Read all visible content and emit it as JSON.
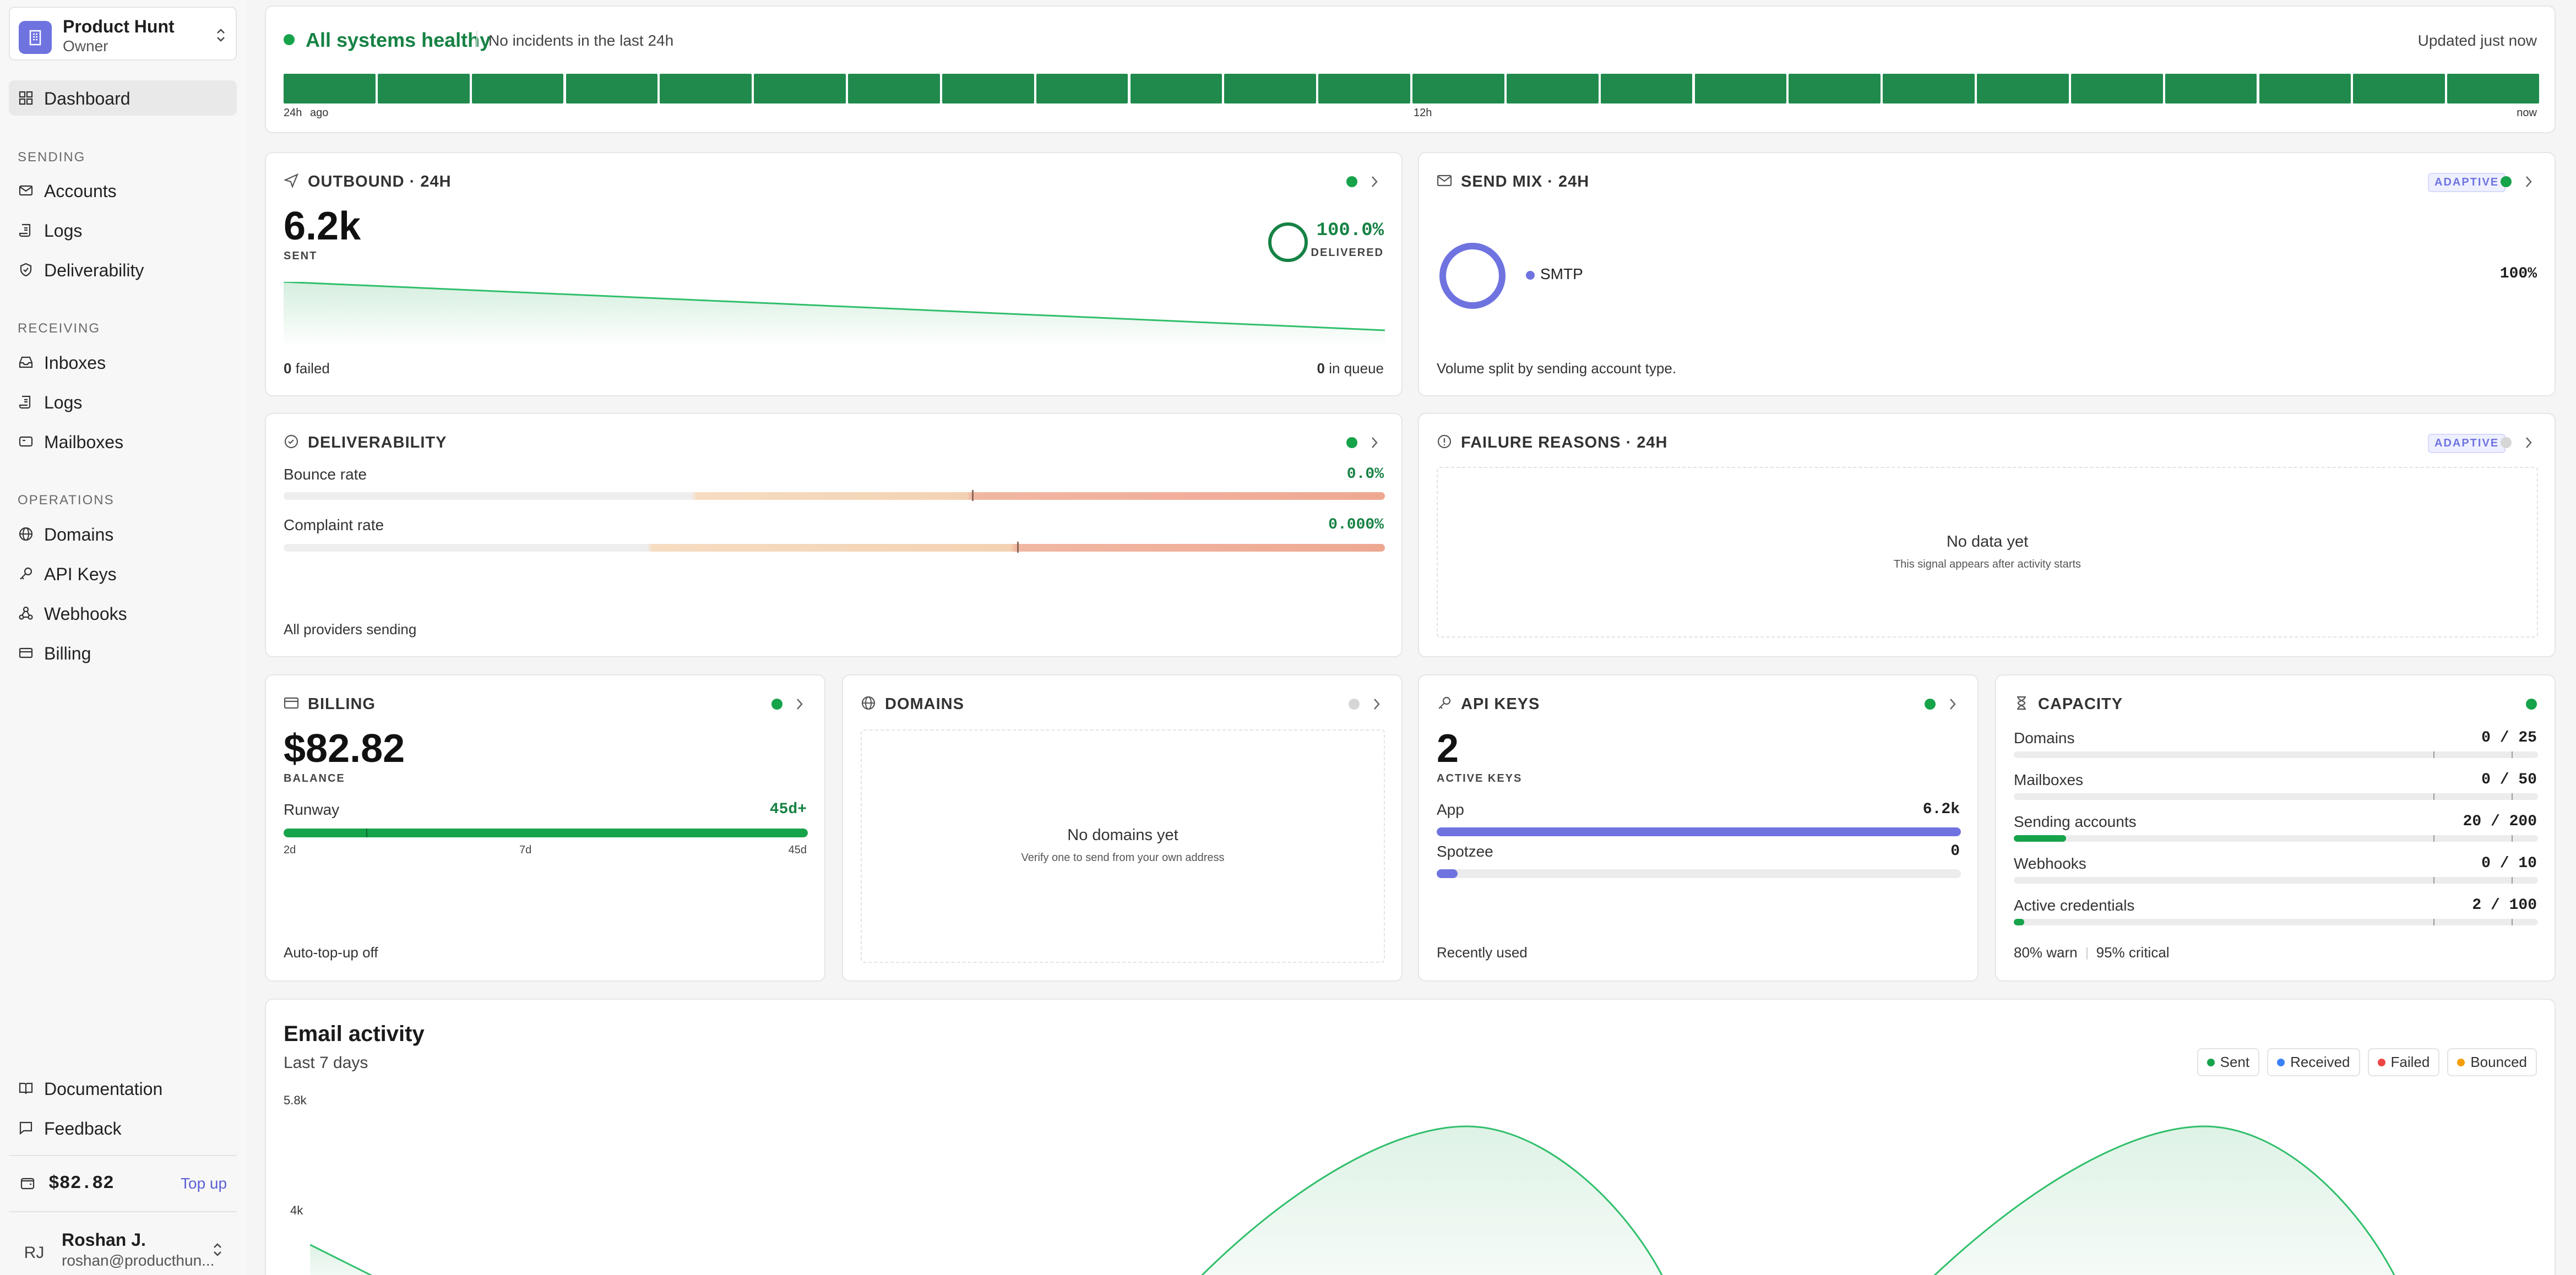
{
  "workspace": {
    "name": "Product Hunt",
    "role": "Owner"
  },
  "nav": {
    "dashboard": "Dashboard",
    "sections": {
      "sending": "SENDING",
      "receiving": "RECEIVING",
      "operations": "OPERATIONS"
    },
    "sending": [
      "Accounts",
      "Logs",
      "Deliverability"
    ],
    "receiving": [
      "Inboxes",
      "Logs",
      "Mailboxes"
    ],
    "operations": [
      "Domains",
      "API Keys",
      "Webhooks",
      "Billing"
    ],
    "bottom": [
      "Documentation",
      "Feedback"
    ]
  },
  "sidebar_balance": {
    "amount": "$82.82",
    "topup": "Top up"
  },
  "user": {
    "initials": "RJ",
    "name": "Roshan J.",
    "email": "roshan@producthun..."
  },
  "status": {
    "title": "All systems healthy",
    "subtitle": "No incidents in the last 24h",
    "updated": "Updated just now",
    "labels": [
      "24h",
      "ago",
      "12h",
      "now"
    ],
    "segments": 24,
    "color": "#1f8a4c"
  },
  "outbound": {
    "title": "OUTBOUND · 24H",
    "sent": "6.2k",
    "sent_caption": "SENT",
    "delivered": "100.0%",
    "delivered_caption": "DELIVERED",
    "failed_count": "0",
    "failed_label": "failed",
    "queue_count": "0",
    "queue_label": "in queue"
  },
  "send_mix": {
    "title": "SEND MIX · 24H",
    "badge": "ADAPTIVE",
    "items": [
      {
        "label": "SMTP",
        "pct": "100%",
        "color": "#6f73e0"
      }
    ],
    "footer": "Volume split by sending account type."
  },
  "deliverability": {
    "title": "DELIVERABILITY",
    "bounce_label": "Bounce rate",
    "bounce_value": "0.0%",
    "complaint_label": "Complaint rate",
    "complaint_value": "0.000%",
    "footer": "All providers sending"
  },
  "failure": {
    "title": "FAILURE REASONS · 24H",
    "badge": "ADAPTIVE",
    "empty_title": "No data yet",
    "empty_sub": "This signal appears after activity starts"
  },
  "billing": {
    "title": "BILLING",
    "balance": "$82.82",
    "balance_caption": "BALANCE",
    "runway_label": "Runway",
    "runway_value": "45d+",
    "runway_fraction": 1.0,
    "ticks": [
      "2d",
      "7d",
      "45d"
    ],
    "footer": "Auto-top-up off"
  },
  "domains": {
    "title": "DOMAINS",
    "empty_title": "No domains yet",
    "empty_sub": "Verify one to send from your own address"
  },
  "api_keys": {
    "title": "API KEYS",
    "count": "2",
    "caption": "ACTIVE KEYS",
    "keys": [
      {
        "name": "App",
        "value": "6.2k",
        "fraction": 1.0
      },
      {
        "name": "Spotzee",
        "value": "0",
        "fraction": 0.04
      }
    ],
    "footer": "Recently used"
  },
  "capacity": {
    "title": "CAPACITY",
    "items": [
      {
        "label": "Domains",
        "value": "0 / 25",
        "fraction": 0
      },
      {
        "label": "Mailboxes",
        "value": "0 / 50",
        "fraction": 0
      },
      {
        "label": "Sending accounts",
        "value": "20 / 200",
        "fraction": 0.1
      },
      {
        "label": "Webhooks",
        "value": "0 / 10",
        "fraction": 0
      },
      {
        "label": "Active credentials",
        "value": "2 / 100",
        "fraction": 0.02
      }
    ],
    "warn": "80% warn",
    "critical": "95% critical"
  },
  "activity": {
    "title": "Email activity",
    "subtitle": "Last 7 days",
    "legend": [
      {
        "label": "Sent",
        "color": "#16a34a"
      },
      {
        "label": "Received",
        "color": "#3b82f6"
      },
      {
        "label": "Failed",
        "color": "#ef4444"
      },
      {
        "label": "Bounced",
        "color": "#f59e0b"
      }
    ],
    "y_ticks": [
      "5.8k",
      "4k"
    ]
  },
  "chart_data": {
    "type": "area",
    "title": "Email activity",
    "subtitle": "Last 7 days",
    "series": [
      {
        "name": "Sent"
      },
      {
        "name": "Received"
      },
      {
        "name": "Failed"
      },
      {
        "name": "Bounced"
      }
    ],
    "ylim": [
      0,
      5800
    ],
    "y_ticks": [
      "5.8k",
      "4k"
    ]
  }
}
